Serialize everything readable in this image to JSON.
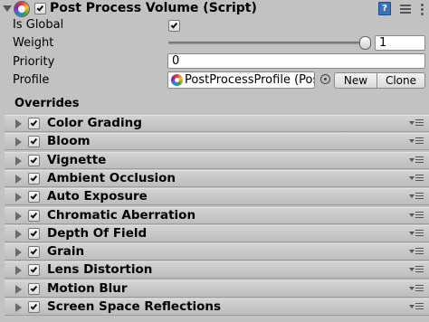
{
  "header": {
    "title": "Post Process Volume (Script)",
    "enabled": true,
    "help_glyph": "?"
  },
  "properties": {
    "is_global": {
      "label": "Is Global",
      "checked": true
    },
    "weight": {
      "label": "Weight",
      "value": "1",
      "slider_fraction": 1.0
    },
    "priority": {
      "label": "Priority",
      "value": "0"
    },
    "profile": {
      "label": "Profile",
      "value": "PostProcessProfile (Pos",
      "new_label": "New",
      "clone_label": "Clone"
    }
  },
  "overrides": {
    "title": "Overrides",
    "items": [
      {
        "label": "Color Grading",
        "checked": true
      },
      {
        "label": "Bloom",
        "checked": true
      },
      {
        "label": "Vignette",
        "checked": true
      },
      {
        "label": "Ambient Occlusion",
        "checked": true
      },
      {
        "label": "Auto Exposure",
        "checked": true
      },
      {
        "label": "Chromatic Aberration",
        "checked": true
      },
      {
        "label": "Depth Of Field",
        "checked": true
      },
      {
        "label": "Grain",
        "checked": true
      },
      {
        "label": "Lens Distortion",
        "checked": true
      },
      {
        "label": "Motion Blur",
        "checked": true
      },
      {
        "label": "Screen Space Reflections",
        "checked": true
      }
    ]
  },
  "icons": {
    "component": "post-process-icon",
    "help": "help-icon",
    "settings": "presets-icon",
    "menu": "menu-icon",
    "fold": "fold-arrow-icon",
    "picker": "object-picker-icon"
  }
}
